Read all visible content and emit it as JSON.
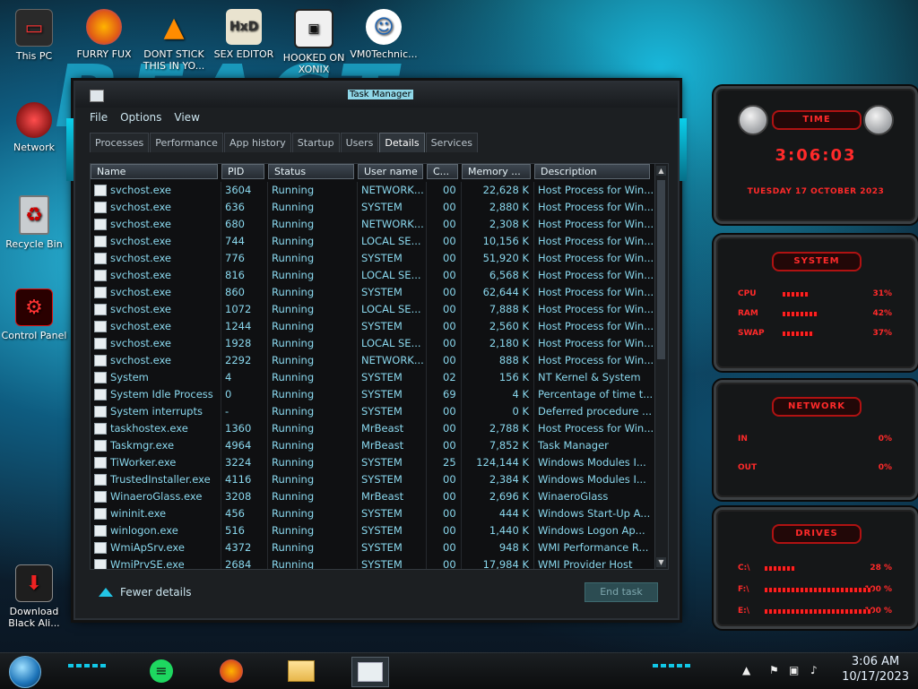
{
  "desktop": {
    "wallpaper_text": "REACT",
    "icons": [
      {
        "label": "This PC",
        "icon": "computer-icon"
      },
      {
        "label": "FURRY FUX",
        "icon": "firefox-icon"
      },
      {
        "label": "DONT STICK THIS IN YO...",
        "icon": "vlc-cone-icon"
      },
      {
        "label": "SEX EDITOR",
        "icon": "hex-editor-icon"
      },
      {
        "label": "HOOKED ON XONIX",
        "icon": "game-icon"
      },
      {
        "label": "VM0Technic...",
        "icon": "doctor-icon"
      },
      {
        "label": "Network",
        "icon": "network-icon"
      },
      {
        "label": "Recycle Bin",
        "icon": "recycle-bin-icon"
      },
      {
        "label": "Control Panel",
        "icon": "control-panel-icon"
      },
      {
        "label": "Download Black Ali...",
        "icon": "download-icon"
      }
    ]
  },
  "task_manager": {
    "title": "Task Manager",
    "menu": [
      "File",
      "Options",
      "View"
    ],
    "tabs": [
      "Processes",
      "Performance",
      "App history",
      "Startup",
      "Users",
      "Details",
      "Services"
    ],
    "active_tab": "Details",
    "columns": [
      "Name",
      "PID",
      "Status",
      "User name",
      "C...",
      "Memory ...",
      "Description"
    ],
    "rows": [
      {
        "name": "svchost.exe",
        "pid": "3604",
        "status": "Running",
        "user": "NETWORK...",
        "cpu": "00",
        "mem": "22,628 K",
        "desc": "Host Process for Win..."
      },
      {
        "name": "svchost.exe",
        "pid": "636",
        "status": "Running",
        "user": "SYSTEM",
        "cpu": "00",
        "mem": "2,880 K",
        "desc": "Host Process for Win..."
      },
      {
        "name": "svchost.exe",
        "pid": "680",
        "status": "Running",
        "user": "NETWORK...",
        "cpu": "00",
        "mem": "2,308 K",
        "desc": "Host Process for Win..."
      },
      {
        "name": "svchost.exe",
        "pid": "744",
        "status": "Running",
        "user": "LOCAL SE...",
        "cpu": "00",
        "mem": "10,156 K",
        "desc": "Host Process for Win..."
      },
      {
        "name": "svchost.exe",
        "pid": "776",
        "status": "Running",
        "user": "SYSTEM",
        "cpu": "00",
        "mem": "51,920 K",
        "desc": "Host Process for Win..."
      },
      {
        "name": "svchost.exe",
        "pid": "816",
        "status": "Running",
        "user": "LOCAL SE...",
        "cpu": "00",
        "mem": "6,568 K",
        "desc": "Host Process for Win..."
      },
      {
        "name": "svchost.exe",
        "pid": "860",
        "status": "Running",
        "user": "SYSTEM",
        "cpu": "00",
        "mem": "62,644 K",
        "desc": "Host Process for Win..."
      },
      {
        "name": "svchost.exe",
        "pid": "1072",
        "status": "Running",
        "user": "LOCAL SE...",
        "cpu": "00",
        "mem": "7,888 K",
        "desc": "Host Process for Win..."
      },
      {
        "name": "svchost.exe",
        "pid": "1244",
        "status": "Running",
        "user": "SYSTEM",
        "cpu": "00",
        "mem": "2,560 K",
        "desc": "Host Process for Win..."
      },
      {
        "name": "svchost.exe",
        "pid": "1928",
        "status": "Running",
        "user": "LOCAL SE...",
        "cpu": "00",
        "mem": "2,180 K",
        "desc": "Host Process for Win..."
      },
      {
        "name": "svchost.exe",
        "pid": "2292",
        "status": "Running",
        "user": "NETWORK...",
        "cpu": "00",
        "mem": "888 K",
        "desc": "Host Process for Win..."
      },
      {
        "name": "System",
        "pid": "4",
        "status": "Running",
        "user": "SYSTEM",
        "cpu": "02",
        "mem": "156 K",
        "desc": "NT Kernel & System"
      },
      {
        "name": "System Idle Process",
        "pid": "0",
        "status": "Running",
        "user": "SYSTEM",
        "cpu": "69",
        "mem": "4 K",
        "desc": "Percentage of time t..."
      },
      {
        "name": "System interrupts",
        "pid": "-",
        "status": "Running",
        "user": "SYSTEM",
        "cpu": "00",
        "mem": "0 K",
        "desc": "Deferred procedure ..."
      },
      {
        "name": "taskhostex.exe",
        "pid": "1360",
        "status": "Running",
        "user": "MrBeast",
        "cpu": "00",
        "mem": "2,788 K",
        "desc": "Host Process for Win..."
      },
      {
        "name": "Taskmgr.exe",
        "pid": "4964",
        "status": "Running",
        "user": "MrBeast",
        "cpu": "00",
        "mem": "7,852 K",
        "desc": "Task Manager"
      },
      {
        "name": "TiWorker.exe",
        "pid": "3224",
        "status": "Running",
        "user": "SYSTEM",
        "cpu": "25",
        "mem": "124,144 K",
        "desc": "Windows Modules I..."
      },
      {
        "name": "TrustedInstaller.exe",
        "pid": "4116",
        "status": "Running",
        "user": "SYSTEM",
        "cpu": "00",
        "mem": "2,384 K",
        "desc": "Windows Modules I..."
      },
      {
        "name": "WinaeroGlass.exe",
        "pid": "3208",
        "status": "Running",
        "user": "MrBeast",
        "cpu": "00",
        "mem": "2,696 K",
        "desc": "WinaeroGlass"
      },
      {
        "name": "wininit.exe",
        "pid": "456",
        "status": "Running",
        "user": "SYSTEM",
        "cpu": "00",
        "mem": "444 K",
        "desc": "Windows Start-Up A..."
      },
      {
        "name": "winlogon.exe",
        "pid": "516",
        "status": "Running",
        "user": "SYSTEM",
        "cpu": "00",
        "mem": "1,440 K",
        "desc": "Windows Logon Ap..."
      },
      {
        "name": "WmiApSrv.exe",
        "pid": "4372",
        "status": "Running",
        "user": "SYSTEM",
        "cpu": "00",
        "mem": "948 K",
        "desc": "WMI Performance R..."
      },
      {
        "name": "WmiPrvSE.exe",
        "pid": "2684",
        "status": "Running",
        "user": "SYSTEM",
        "cpu": "00",
        "mem": "17,984 K",
        "desc": "WMI Provider Host"
      }
    ],
    "fewer_details": "Fewer details",
    "end_task": "End task"
  },
  "gadgets": {
    "time": {
      "header": "TIME",
      "clock": "3:06:03",
      "date": "TUESDAY 17 OCTOBER 2023"
    },
    "system": {
      "header": "SYSTEM",
      "cpu_label": "CPU",
      "cpu_value": "31%",
      "ram_label": "RAM",
      "ram_value": "42%",
      "swap_label": "SWAP",
      "swap_value": "37%"
    },
    "network": {
      "header": "NETWORK",
      "in_label": "IN",
      "in_value": "0%",
      "out_label": "OUT",
      "out_value": "0%"
    },
    "drives": {
      "header": "DRIVES",
      "c_label": "C:\\",
      "c_value": "28 %",
      "f_label": "F:\\",
      "f_value": "100 %",
      "e_label": "E:\\",
      "e_value": "100 %"
    }
  },
  "taskbar": {
    "time": "3:06 AM",
    "date": "10/17/2023",
    "pinned": [
      "spotify-icon",
      "firefox-icon",
      "file-explorer-icon",
      "task-manager-icon"
    ]
  }
}
